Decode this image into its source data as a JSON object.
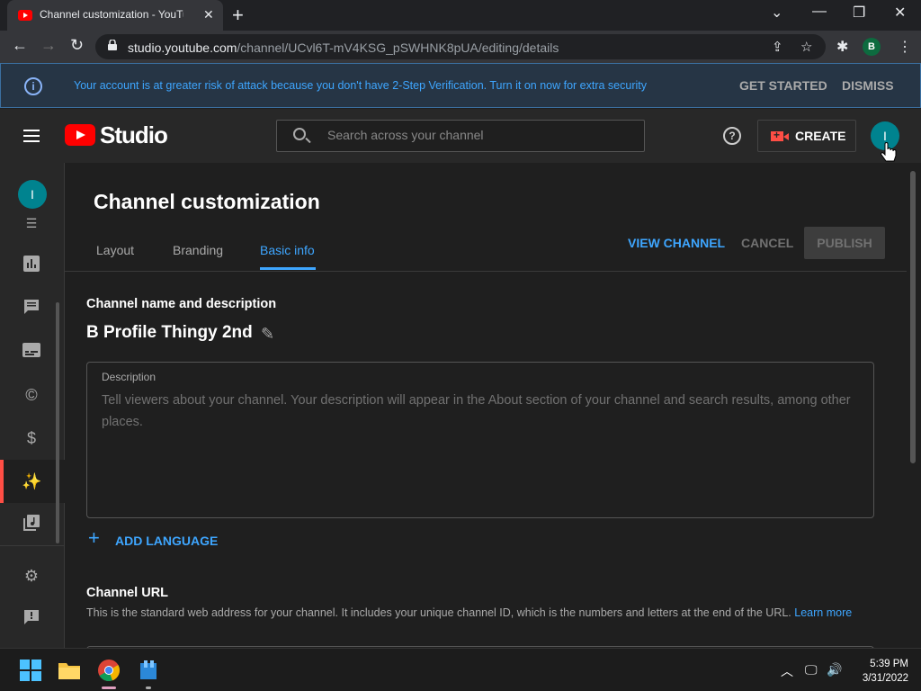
{
  "browser": {
    "tab_title": "Channel customization - YouTube",
    "url_host": "studio.youtube.com",
    "url_path": "/channel/UCvl6T-mV4KSG_pSWHNK8pUA/editing/details",
    "profile_initial": "B"
  },
  "banner": {
    "message": "Your account is at greater risk of attack because you don't have 2-Step Verification. Turn it on now for extra security",
    "get_started": "GET STARTED",
    "dismiss": "DISMISS"
  },
  "header": {
    "logo_text": "Studio",
    "search_placeholder": "Search across your channel",
    "create_label": "CREATE",
    "avatar_initial": "I"
  },
  "sidebar": {
    "avatar_initial": "I",
    "items": [
      {
        "icon": "content-icon"
      },
      {
        "icon": "analytics-icon"
      },
      {
        "icon": "comments-icon"
      },
      {
        "icon": "subtitles-icon"
      },
      {
        "icon": "copyright-icon"
      },
      {
        "icon": "earn-icon"
      },
      {
        "icon": "customization-icon",
        "active": true
      },
      {
        "icon": "audio-library-icon"
      },
      {
        "icon": "settings-icon"
      },
      {
        "icon": "feedback-icon"
      }
    ]
  },
  "page": {
    "title": "Channel customization",
    "tabs": [
      {
        "label": "Layout"
      },
      {
        "label": "Branding"
      },
      {
        "label": "Basic info",
        "active": true
      }
    ],
    "view_channel": "VIEW CHANNEL",
    "cancel": "CANCEL",
    "publish": "PUBLISH"
  },
  "basic_info": {
    "name_section_title": "Channel name and description",
    "channel_name": "B Profile Thingy 2nd",
    "description_label": "Description",
    "description_placeholder": "Tell viewers about your channel. Your description will appear in the About section of your channel and search results, among other places.",
    "add_language": "ADD LANGUAGE",
    "url_section_title": "Channel URL",
    "url_description": "This is the standard web address for your channel. It includes your unique channel ID, which is the numbers and letters at the end of the URL.",
    "learn_more": "Learn more"
  },
  "taskbar": {
    "time": "5:39 PM",
    "date": "3/31/2022"
  },
  "colors": {
    "accent_blue": "#3ea6ff",
    "brand_red": "#ff0000",
    "active_red": "#ff4e45",
    "background": "#1f1f1f"
  }
}
